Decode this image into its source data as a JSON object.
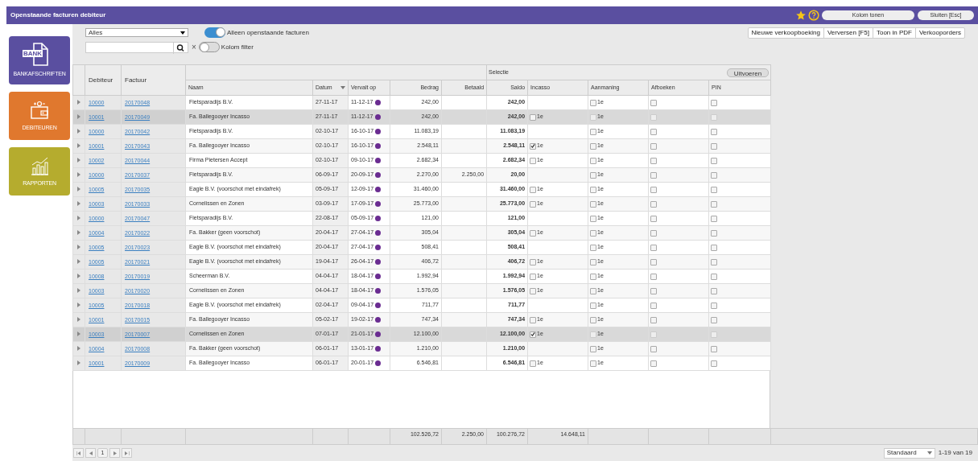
{
  "window": {
    "title": "Openstaande facturen debiteur"
  },
  "header_buttons": [
    "Kolom tonen",
    "Sluiten [Esc]"
  ],
  "sidebar": {
    "items": [
      {
        "label": "BANKAFSCHRIFTEN",
        "kind": "bank",
        "badge": "BANK"
      },
      {
        "label": "DEBITEUREN",
        "kind": "debtors"
      },
      {
        "label": "RAPPORTEN",
        "kind": "reports"
      }
    ]
  },
  "filter": {
    "dropdown": "Alles",
    "clear": "×",
    "toggles": [
      {
        "label": "Alleen openstaande facturen",
        "on": true
      },
      {
        "label": "Kolom filter",
        "on": false
      }
    ]
  },
  "toolbar": [
    "Nieuwe verkoopboeking",
    "Verversen [F5]",
    "Toon in PDF",
    "Verkooporders"
  ],
  "table": {
    "group_label": "Selectie",
    "run_button": "Uitvoeren",
    "columns": [
      "Debiteur",
      "Factuur",
      "Naam",
      "Datum",
      "Vervalt op",
      "Bedrag",
      "Betaald",
      "Saldo",
      "Incasso",
      "Aanmaning",
      "Afboeken",
      "PIN"
    ],
    "rows": [
      {
        "debiteur": "10000",
        "factuur": "20170048",
        "naam": "Fietsparadijs B.V.",
        "datum": "27-11-17",
        "vervalt_op": "11-12-17",
        "bedrag": "242,00",
        "betaald": "",
        "saldo": "242,00",
        "incasso": null,
        "aanmaning": {
          "label": "1e",
          "checked": false
        },
        "afboeken": false,
        "pin": false,
        "selected": false
      },
      {
        "debiteur": "10001",
        "factuur": "20170049",
        "naam": "Fa. Ballegooyer Incasso",
        "datum": "27-11-17",
        "vervalt_op": "11-12-17",
        "bedrag": "242,00",
        "betaald": "",
        "saldo": "242,00",
        "incasso": {
          "label": "1e",
          "checked": false
        },
        "aanmaning": {
          "label": "1e",
          "checked": false
        },
        "afboeken": false,
        "pin": false,
        "selected": true
      },
      {
        "debiteur": "10000",
        "factuur": "20170042",
        "naam": "Fietsparadijs B.V.",
        "datum": "02-10-17",
        "vervalt_op": "16-10-17",
        "bedrag": "11.083,19",
        "betaald": "",
        "saldo": "11.083,19",
        "incasso": null,
        "aanmaning": {
          "label": "1e",
          "checked": false
        },
        "afboeken": false,
        "pin": false,
        "selected": false
      },
      {
        "debiteur": "10001",
        "factuur": "20170043",
        "naam": "Fa. Ballegooyer Incasso",
        "datum": "02-10-17",
        "vervalt_op": "16-10-17",
        "bedrag": "2.548,11",
        "betaald": "",
        "saldo": "2.548,11",
        "incasso": {
          "label": "1e",
          "checked": true
        },
        "aanmaning": {
          "label": "1e",
          "checked": false
        },
        "afboeken": false,
        "pin": false,
        "selected": false
      },
      {
        "debiteur": "10002",
        "factuur": "20170044",
        "naam": "Firma Pietersen Accept",
        "datum": "02-10-17",
        "vervalt_op": "09-10-17",
        "bedrag": "2.682,34",
        "betaald": "",
        "saldo": "2.682,34",
        "incasso": {
          "label": "1e",
          "checked": false
        },
        "aanmaning": {
          "label": "1e",
          "checked": false
        },
        "afboeken": false,
        "pin": false,
        "selected": false
      },
      {
        "debiteur": "10000",
        "factuur": "20170037",
        "naam": "Fietsparadijs B.V.",
        "datum": "06-09-17",
        "vervalt_op": "20-09-17",
        "bedrag": "2.270,00",
        "betaald": "2.250,00",
        "saldo": "20,00",
        "incasso": null,
        "aanmaning": {
          "label": "1e",
          "checked": false
        },
        "afboeken": false,
        "pin": false,
        "selected": false
      },
      {
        "debiteur": "10005",
        "factuur": "20170035",
        "naam": "Eagle B.V. (voorschot met eindafrek)",
        "datum": "05-09-17",
        "vervalt_op": "12-09-17",
        "bedrag": "31.460,00",
        "betaald": "",
        "saldo": "31.460,00",
        "incasso": {
          "label": "1e",
          "checked": false
        },
        "aanmaning": {
          "label": "1e",
          "checked": false
        },
        "afboeken": false,
        "pin": false,
        "selected": false
      },
      {
        "debiteur": "10003",
        "factuur": "20170033",
        "naam": "Cornelissen en Zonen",
        "datum": "03-09-17",
        "vervalt_op": "17-09-17",
        "bedrag": "25.773,00",
        "betaald": "",
        "saldo": "25.773,00",
        "incasso": {
          "label": "1e",
          "checked": false
        },
        "aanmaning": {
          "label": "1e",
          "checked": false
        },
        "afboeken": false,
        "pin": false,
        "selected": false
      },
      {
        "debiteur": "10000",
        "factuur": "20170047",
        "naam": "Fietsparadijs B.V.",
        "datum": "22-08-17",
        "vervalt_op": "05-09-17",
        "bedrag": "121,00",
        "betaald": "",
        "saldo": "121,00",
        "incasso": null,
        "aanmaning": {
          "label": "1e",
          "checked": false
        },
        "afboeken": false,
        "pin": false,
        "selected": false
      },
      {
        "debiteur": "10004",
        "factuur": "20170022",
        "naam": "Fa. Bakker (geen voorschot)",
        "datum": "20-04-17",
        "vervalt_op": "27-04-17",
        "bedrag": "305,04",
        "betaald": "",
        "saldo": "305,04",
        "incasso": {
          "label": "1e",
          "checked": false
        },
        "aanmaning": {
          "label": "1e",
          "checked": false
        },
        "afboeken": false,
        "pin": false,
        "selected": false
      },
      {
        "debiteur": "10005",
        "factuur": "20170023",
        "naam": "Eagle B.V. (voorschot met eindafrek)",
        "datum": "20-04-17",
        "vervalt_op": "27-04-17",
        "bedrag": "508,41",
        "betaald": "",
        "saldo": "508,41",
        "incasso": null,
        "aanmaning": {
          "label": "1e",
          "checked": false
        },
        "afboeken": false,
        "pin": false,
        "selected": false
      },
      {
        "debiteur": "10005",
        "factuur": "20170021",
        "naam": "Eagle B.V. (voorschot met eindafrek)",
        "datum": "19-04-17",
        "vervalt_op": "26-04-17",
        "bedrag": "406,72",
        "betaald": "",
        "saldo": "406,72",
        "incasso": {
          "label": "1e",
          "checked": false
        },
        "aanmaning": {
          "label": "1e",
          "checked": false
        },
        "afboeken": false,
        "pin": false,
        "selected": false
      },
      {
        "debiteur": "10008",
        "factuur": "20170019",
        "naam": "Scheerman B.V.",
        "datum": "04-04-17",
        "vervalt_op": "18-04-17",
        "bedrag": "1.992,94",
        "betaald": "",
        "saldo": "1.992,94",
        "incasso": {
          "label": "1e",
          "checked": false
        },
        "aanmaning": {
          "label": "1e",
          "checked": false
        },
        "afboeken": false,
        "pin": false,
        "selected": false
      },
      {
        "debiteur": "10003",
        "factuur": "20170020",
        "naam": "Cornelissen en Zonen",
        "datum": "04-04-17",
        "vervalt_op": "18-04-17",
        "bedrag": "1.576,05",
        "betaald": "",
        "saldo": "1.576,05",
        "incasso": {
          "label": "1e",
          "checked": false
        },
        "aanmaning": {
          "label": "1e",
          "checked": false
        },
        "afboeken": false,
        "pin": false,
        "selected": false
      },
      {
        "debiteur": "10005",
        "factuur": "20170018",
        "naam": "Eagle B.V. (voorschot met eindafrek)",
        "datum": "02-04-17",
        "vervalt_op": "09-04-17",
        "bedrag": "711,77",
        "betaald": "",
        "saldo": "711,77",
        "incasso": null,
        "aanmaning": {
          "label": "1e",
          "checked": false
        },
        "afboeken": false,
        "pin": false,
        "selected": false
      },
      {
        "debiteur": "10001",
        "factuur": "20170015",
        "naam": "Fa. Ballegooyer Incasso",
        "datum": "05-02-17",
        "vervalt_op": "19-02-17",
        "bedrag": "747,34",
        "betaald": "",
        "saldo": "747,34",
        "incasso": {
          "label": "1e",
          "checked": false
        },
        "aanmaning": {
          "label": "1e",
          "checked": false
        },
        "afboeken": false,
        "pin": false,
        "selected": false
      },
      {
        "debiteur": "10003",
        "factuur": "20170007",
        "naam": "Cornelissen en Zonen",
        "datum": "07-01-17",
        "vervalt_op": "21-01-17",
        "bedrag": "12.100,00",
        "betaald": "",
        "saldo": "12.100,00",
        "incasso": {
          "label": "1e",
          "checked": true
        },
        "aanmaning": {
          "label": "1e",
          "checked": false
        },
        "afboeken": false,
        "pin": false,
        "selected": true
      },
      {
        "debiteur": "10004",
        "factuur": "20170008",
        "naam": "Fa. Bakker (geen voorschot)",
        "datum": "06-01-17",
        "vervalt_op": "13-01-17",
        "bedrag": "1.210,00",
        "betaald": "",
        "saldo": "1.210,00",
        "incasso": null,
        "aanmaning": {
          "label": "1e",
          "checked": false
        },
        "afboeken": false,
        "pin": false,
        "selected": false
      },
      {
        "debiteur": "10001",
        "factuur": "20170009",
        "naam": "Fa. Ballegooyer Incasso",
        "datum": "06-01-17",
        "vervalt_op": "20-01-17",
        "bedrag": "6.546,81",
        "betaald": "",
        "saldo": "6.546,81",
        "incasso": {
          "label": "1e",
          "checked": false
        },
        "aanmaning": {
          "label": "1e",
          "checked": false
        },
        "afboeken": false,
        "pin": false,
        "selected": false
      }
    ],
    "totals": {
      "bedrag": "102.526,72",
      "betaald": "2.250,00",
      "saldo": "100.276,72",
      "incasso": "14.648,11"
    }
  },
  "pager": {
    "page": "1",
    "view": "Standaard",
    "range": "1-19 van 19"
  }
}
